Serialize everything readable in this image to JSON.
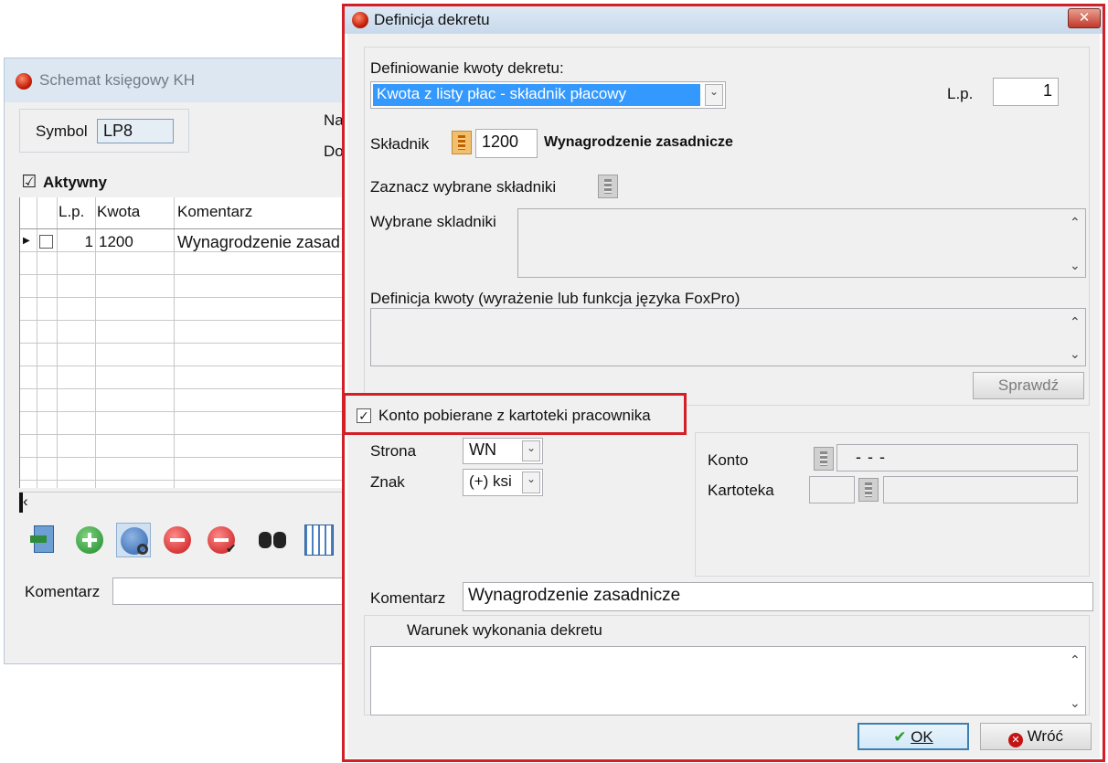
{
  "back_window": {
    "title": "Schemat księgowy KH",
    "symbol_label": "Symbol",
    "symbol_value": "LP8",
    "na_label": "Na",
    "do_label": "Do",
    "active_label": "Aktywny",
    "active_checked": "☑",
    "grid": {
      "headers": {
        "lp": "L.p.",
        "kwota": "Kwota",
        "komentarz": "Komentarz"
      },
      "row": {
        "lp": "1",
        "kwota": "1200",
        "komentarz": "Wynagrodzenie zasad"
      }
    },
    "komentarz_label": "Komentarz"
  },
  "dialog": {
    "title": "Definicja dekretu",
    "close_glyph": "✕",
    "def_amount_label": "Definiowanie kwoty dekretu:",
    "def_amount_value": "Kwota z listy płac - składnik płacowy",
    "lp_label": "L.p.",
    "lp_value": "1",
    "skladnik_label": "Składnik",
    "skladnik_code": "1200",
    "skladnik_name": "Wynagrodzenie zasadnicze",
    "zaznacz_label": "Zaznacz wybrane składniki",
    "wybrane_label": "Wybrane skladniki",
    "definicja_label": "Definicja kwoty (wyrażenie lub funkcja języka  FoxPro)",
    "sprawdz_label": "Sprawdź",
    "konto_checkbox_label": "Konto pobierane z kartoteki pracownika",
    "konto_checked": "✓",
    "strona_label": "Strona",
    "strona_value": "WN",
    "znak_label": "Znak",
    "znak_value": "(+) ksi",
    "konto_label": "Konto",
    "konto_value": "-   -   -",
    "kartoteka_label": "Kartoteka",
    "komentarz_label": "Komentarz",
    "komentarz_value": "Wynagrodzenie zasadnicze",
    "warunek_label": "Warunek wykonania dekretu",
    "ok_label": "OK",
    "wroc_label": "Wróć"
  },
  "colors": {
    "highlight": "#d31f26",
    "selection": "#3399ff"
  }
}
